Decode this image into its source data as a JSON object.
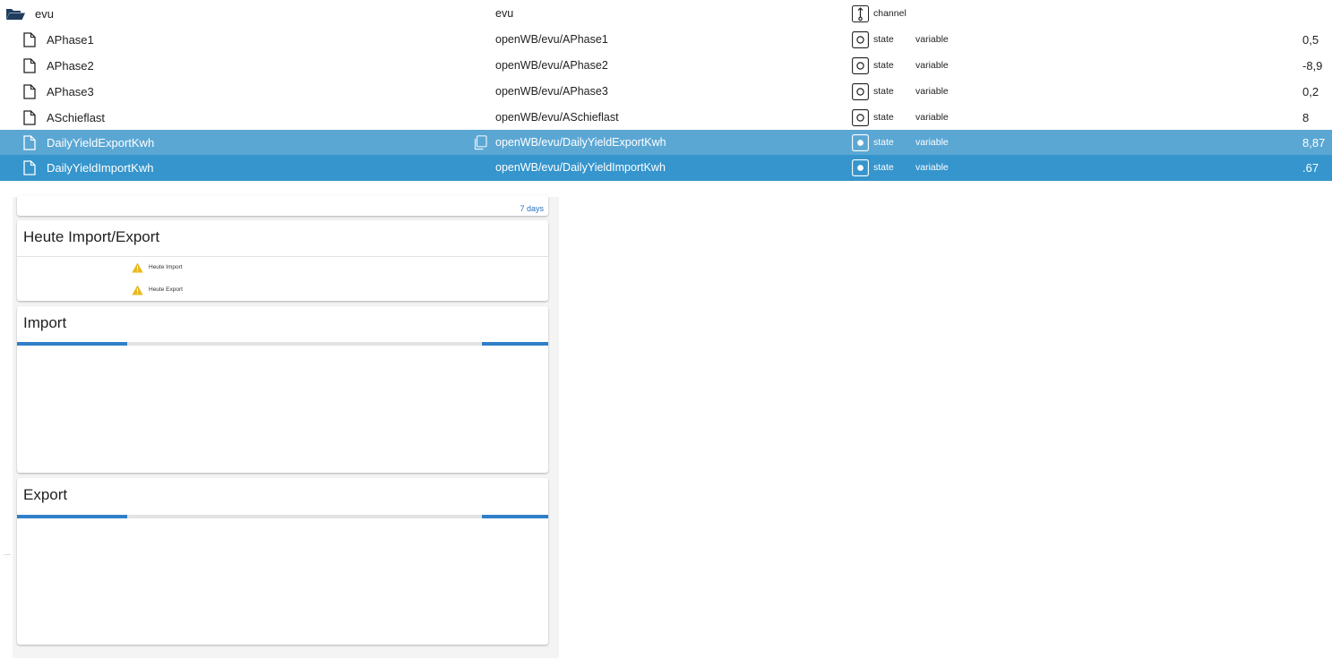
{
  "tree": {
    "folder": {
      "name": "evu",
      "id": "evu",
      "type": "channel",
      "icon": "folder-open-icon"
    },
    "rows": [
      {
        "name": "APhase1",
        "id": "openWB/evu/APhase1",
        "type": "state",
        "role": "variable",
        "value": "0,5"
      },
      {
        "name": "APhase2",
        "id": "openWB/evu/APhase2",
        "type": "state",
        "role": "variable",
        "value": "-8,9"
      },
      {
        "name": "APhase3",
        "id": "openWB/evu/APhase3",
        "type": "state",
        "role": "variable",
        "value": "0,2"
      },
      {
        "name": "ASchieflast",
        "id": "openWB/evu/ASchieflast",
        "type": "state",
        "role": "variable",
        "value": "8"
      },
      {
        "name": "DailyYieldExportKwh",
        "id": "openWB/evu/DailyYieldExportKwh",
        "type": "state",
        "role": "variable",
        "value": "8,87"
      },
      {
        "name": "DailyYieldImportKwh",
        "id": "openWB/evu/DailyYieldImportKwh",
        "type": "state",
        "role": "variable",
        "value": ".67"
      }
    ]
  },
  "dashboard": {
    "top_card": {
      "link": "7 days"
    },
    "today_card": {
      "title": "Heute Import/Export",
      "entries": [
        "Heute Import",
        "Heute Export"
      ]
    },
    "import_card": {
      "title": "Import",
      "progress_fraction": 0.21
    },
    "export_card": {
      "title": "Export",
      "progress_fraction": 0.21
    }
  },
  "colors": {
    "selected_row": "#5ba7d4",
    "active_row": "#3595cc",
    "progress": "#2f7fc9",
    "warning": "#e8b820"
  }
}
